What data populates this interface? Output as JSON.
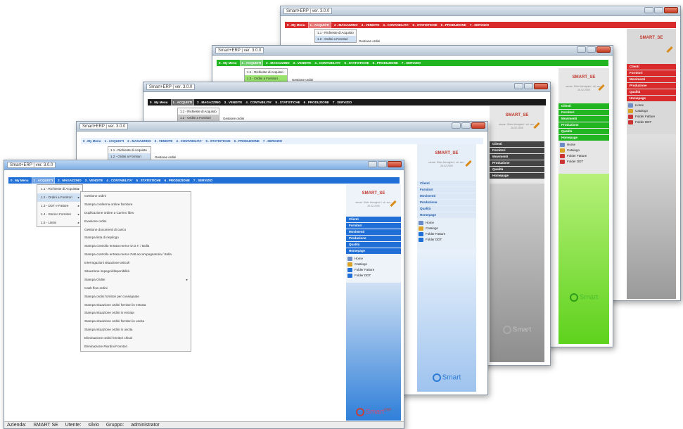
{
  "window_title": "Smart+ERP | ver. 3.0.0",
  "menu_items": [
    "0 . My Menu",
    "1 . ACQUISTI",
    "2 . MAGAZZINO",
    "3 . VENDITE",
    "4 . CONTABILITA'",
    "5 . STATISTICHE",
    "6 . PRODUZIONE",
    "7 . SERVIZIO"
  ],
  "acquisti_submenu": [
    "1.1 - Richieste di Acquisto",
    "1.2 - Ordini a Fornitori",
    "1.3 - DDT e Fatture",
    "1.4 - Storico Fornitori",
    "1.5 - Listini"
  ],
  "gestione_ordini": "Gestione ordini",
  "ordini_menu": [
    "Gestione ordini",
    "Stampa conferma ordine fornitore",
    "Duplicazione ordine a Carrino libro",
    "Evasione ordini",
    "Gestione documenti di carico",
    "Stampa lista di riepilogo",
    "Stampa controllo entrata merce D.D.T. / Bolla",
    "Stampa controllo entrata merce Fatt.accompagnatoria / Bolla",
    "Interrogazioni situazione articoli",
    "Situazione impegni/disponibilità",
    "Stampa Ordini",
    "Cash flow ordini",
    "Stampa ordini fornitori per consegnate",
    "Stampa situazione ordini fornitori in entrata",
    "Stampa situazione ordini in entrata",
    "Stampa situazione ordini fornitori in uscita",
    "Stampa situazione ordini in uscita",
    "Eliminazione ordini fornitori chiusi",
    "Eliminazione Riordini Fornitori"
  ],
  "brand": "SMART_SE",
  "brand_info": "utente: Silvio Menighini / ult. acc.: 26.02.2009",
  "side_menu": [
    "Clienti",
    "Fornitori",
    "Movimenti",
    "Produzione",
    "Qualità",
    "Homepage"
  ],
  "links": [
    "Home",
    "Catalogo",
    "Folder Fatture",
    "Folder DDT"
  ],
  "logo_text": "Smart",
  "logo_suffix": "ERP",
  "status": {
    "azienda": "Azienda:",
    "azienda_val": "SMART SE",
    "utente": "Utente:",
    "utente_val": "silvio",
    "gruppo": "Gruppo:",
    "gruppo_val": "administrator"
  },
  "colors": {
    "blue": "#1f6fd6",
    "red": "#d92b2b",
    "green": "#22b522",
    "black": "#1a1a1a",
    "pale_blue": "#6aa6e8"
  }
}
